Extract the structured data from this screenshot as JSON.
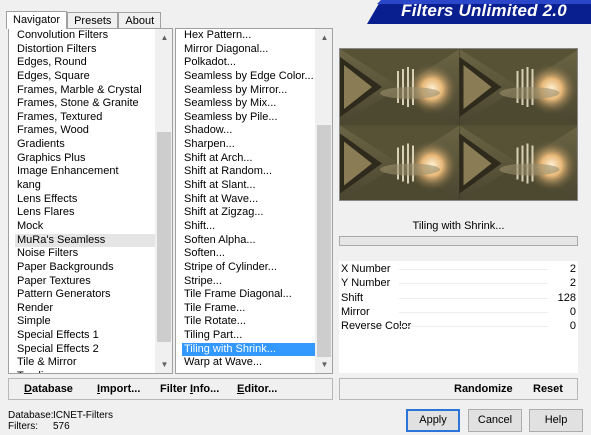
{
  "window": {
    "title": "Filters Unlimited 2.0"
  },
  "tabs": [
    {
      "label": "Navigator",
      "active": true
    },
    {
      "label": "Presets",
      "active": false
    },
    {
      "label": "About",
      "active": false
    }
  ],
  "categories": {
    "items": [
      "Convolution Filters",
      "Distortion Filters",
      "Edges, Round",
      "Edges, Square",
      "Frames, Marble & Crystal",
      "Frames, Stone & Granite",
      "Frames, Textured",
      "Frames, Wood",
      "Gradients",
      "Graphics Plus",
      "Image Enhancement",
      "kang",
      "Lens Effects",
      "Lens Flares",
      "Mock",
      "MuRa's Seamless",
      "Noise Filters",
      "Paper Backgrounds",
      "Paper Textures",
      "Pattern Generators",
      "Render",
      "Simple",
      "Special Effects 1",
      "Special Effects 2",
      "Tile & Mirror",
      "Toadies"
    ],
    "selected": "MuRa's Seamless"
  },
  "filters": {
    "items": [
      "Hex Pattern...",
      "Mirror Diagonal...",
      "Polkadot...",
      "Seamless by Edge Color...",
      "Seamless by Mirror...",
      "Seamless by Mix...",
      "Seamless by Pile...",
      "Shadow...",
      "Sharpen...",
      "Shift at Arch...",
      "Shift at Random...",
      "Shift at Slant...",
      "Shift at Wave...",
      "Shift at Zigzag...",
      "Shift...",
      "Soften Alpha...",
      "Soften...",
      "Stripe of Cylinder...",
      "Stripe...",
      "Tile Frame Diagonal...",
      "Tile Frame...",
      "Tile Rotate...",
      "Tiling Part...",
      "Tiling with Shrink...",
      "Warp at Wave..."
    ],
    "selected": "Tiling with Shrink..."
  },
  "preview": {
    "filter_name": "Tiling with Shrink...",
    "colors": {
      "base": "#5c5638",
      "glow": "#f3d4a2",
      "dark": "#2e2a1c"
    }
  },
  "parameters": [
    {
      "name": "X Number",
      "value": "2"
    },
    {
      "name": "Y Number",
      "value": "2"
    },
    {
      "name": "Shift",
      "value": "128"
    },
    {
      "name": "Mirror",
      "value": "0"
    },
    {
      "name": "Reverse Color",
      "value": "0"
    }
  ],
  "footer_left": {
    "database": "Database",
    "import": "Import...",
    "filter_info": "Filter Info...",
    "editor": "Editor..."
  },
  "footer_right": {
    "randomize": "Randomize",
    "reset": "Reset"
  },
  "status": {
    "database_label": "Database:",
    "database_value": "ICNET-Filters",
    "filters_label": "Filters:",
    "filters_value": "576"
  },
  "buttons": {
    "apply": "Apply",
    "cancel": "Cancel",
    "help": "Help"
  },
  "accent_color": "#3399ff"
}
